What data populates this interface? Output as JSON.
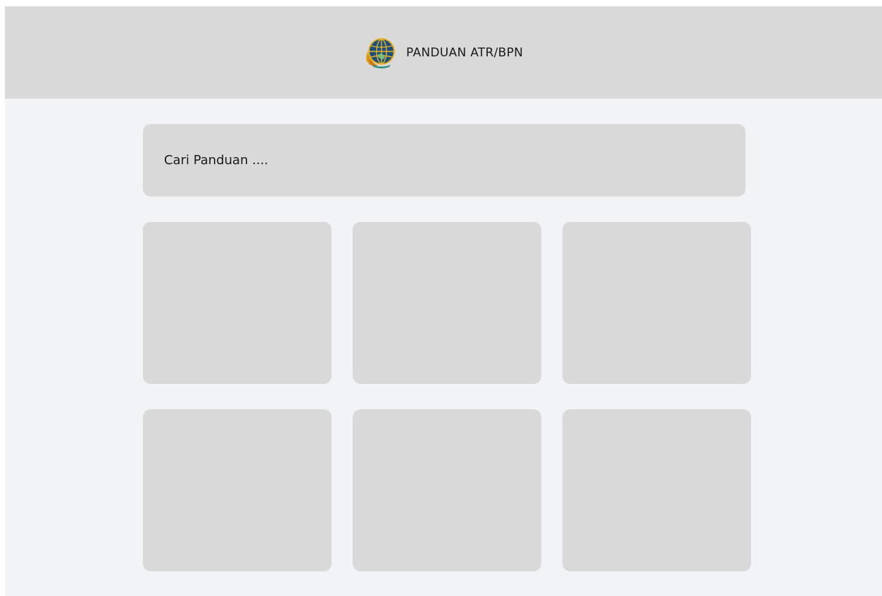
{
  "header": {
    "logo_icon": "atr-bpn-logo-icon",
    "title": "PANDUAN ATR/BPN"
  },
  "search": {
    "placeholder": "Cari Panduan ...."
  },
  "cards": [
    {
      "id": "card-1"
    },
    {
      "id": "card-2"
    },
    {
      "id": "card-3"
    },
    {
      "id": "card-4"
    },
    {
      "id": "card-5"
    },
    {
      "id": "card-6"
    }
  ],
  "colors": {
    "header_bg": "#d9d9d9",
    "page_bg": "#f2f3f7",
    "card_bg": "#d9d9d9",
    "text": "#1a1a1a"
  }
}
